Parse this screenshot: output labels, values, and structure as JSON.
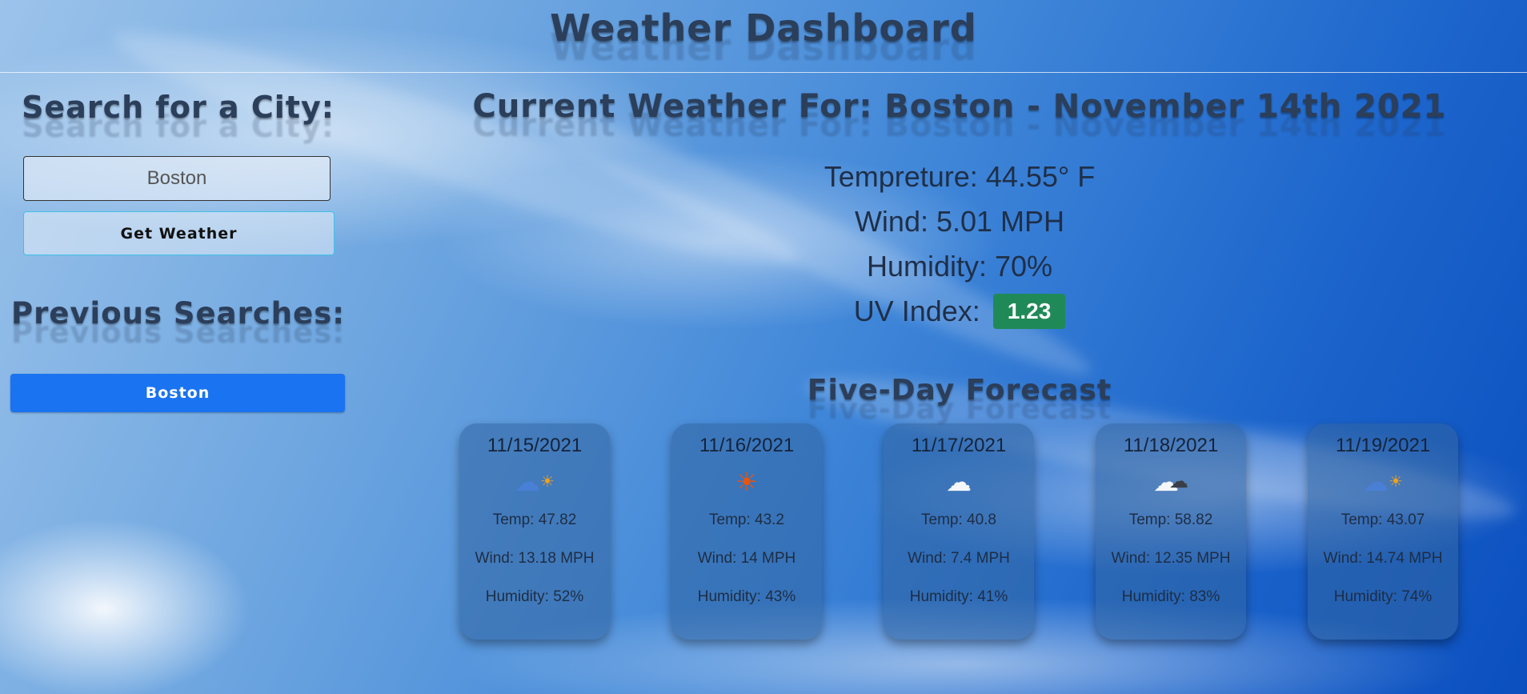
{
  "app": {
    "title": "Weather Dashboard"
  },
  "sidebar": {
    "search_title": "Search for a City:",
    "search_input": {
      "value": "Boston",
      "placeholder": ""
    },
    "get_weather_label": "Get Weather",
    "previous_title": "Previous Searches:",
    "history": [
      "Boston"
    ]
  },
  "current": {
    "title": "Current Weather For: Boston - November 14th 2021",
    "temperature": "Tempreture: 44.55° F",
    "wind": "Wind: 5.01 MPH",
    "humidity": "Humidity: 70%",
    "uv_label": "UV Index:",
    "uv_value": "1.23",
    "uv_color": "#1f8a57"
  },
  "forecast": {
    "title": "Five-Day Forecast",
    "days": [
      {
        "date": "11/15/2021",
        "icon": "rain-sun-icon",
        "icon_glyph": "🌦",
        "temp": "Temp: 47.82",
        "wind": "Wind: 13.18 MPH",
        "humidity": "Humidity: 52%"
      },
      {
        "date": "11/16/2021",
        "icon": "sun-icon",
        "icon_glyph": "☀",
        "temp": "Temp: 43.2",
        "wind": "Wind: 14 MPH",
        "humidity": "Humidity: 43%"
      },
      {
        "date": "11/17/2021",
        "icon": "cloud-icon",
        "icon_glyph": "☁",
        "temp": "Temp: 40.8",
        "wind": "Wind: 7.4 MPH",
        "humidity": "Humidity: 41%"
      },
      {
        "date": "11/18/2021",
        "icon": "clouds-icon",
        "icon_glyph": "☁",
        "temp": "Temp: 58.82",
        "wind": "Wind: 12.35 MPH",
        "humidity": "Humidity: 83%"
      },
      {
        "date": "11/19/2021",
        "icon": "rain-sun-icon",
        "icon_glyph": "🌦",
        "temp": "Temp: 43.07",
        "wind": "Wind: 14.74 MPH",
        "humidity": "Humidity: 74%"
      }
    ]
  },
  "colors": {
    "history_button": "#1a73f0",
    "get_weather_border": "#3fc1e6",
    "heading_text": "#2b3e5a"
  }
}
